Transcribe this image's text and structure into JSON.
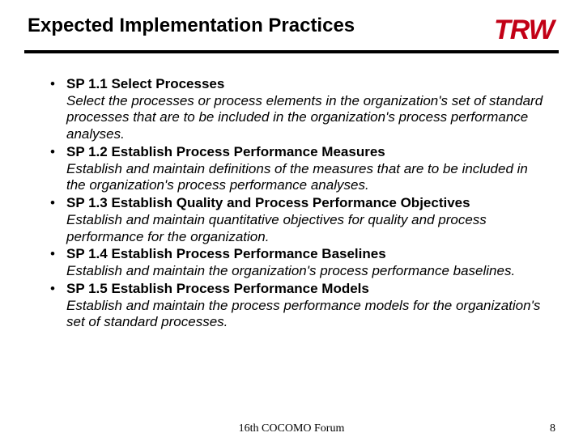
{
  "header": {
    "title": "Expected Implementation Practices",
    "logo_text": "TRW"
  },
  "items": [
    {
      "title": "SP 1.1 Select Processes",
      "body": "Select the processes or process elements in the organization's set of standard processes that are to be included in the organization's process performance analyses."
    },
    {
      "title": "SP 1.2 Establish Process Performance Measures",
      "body": "Establish and maintain definitions of the measures that are to be included in the organization's process performance analyses."
    },
    {
      "title": "SP 1.3 Establish Quality and Process Performance Objectives",
      "body": "Establish and maintain quantitative objectives for quality and process performance for the organization."
    },
    {
      "title": "SP 1.4 Establish Process Performance Baselines",
      "body": "Establish and maintain the organization's process performance baselines."
    },
    {
      "title": "SP 1.5 Establish Process Performance Models",
      "body": "Establish and maintain the process performance models for the organization's set of standard processes."
    }
  ],
  "footer": {
    "center": "16th COCOMO Forum",
    "page": "8"
  }
}
